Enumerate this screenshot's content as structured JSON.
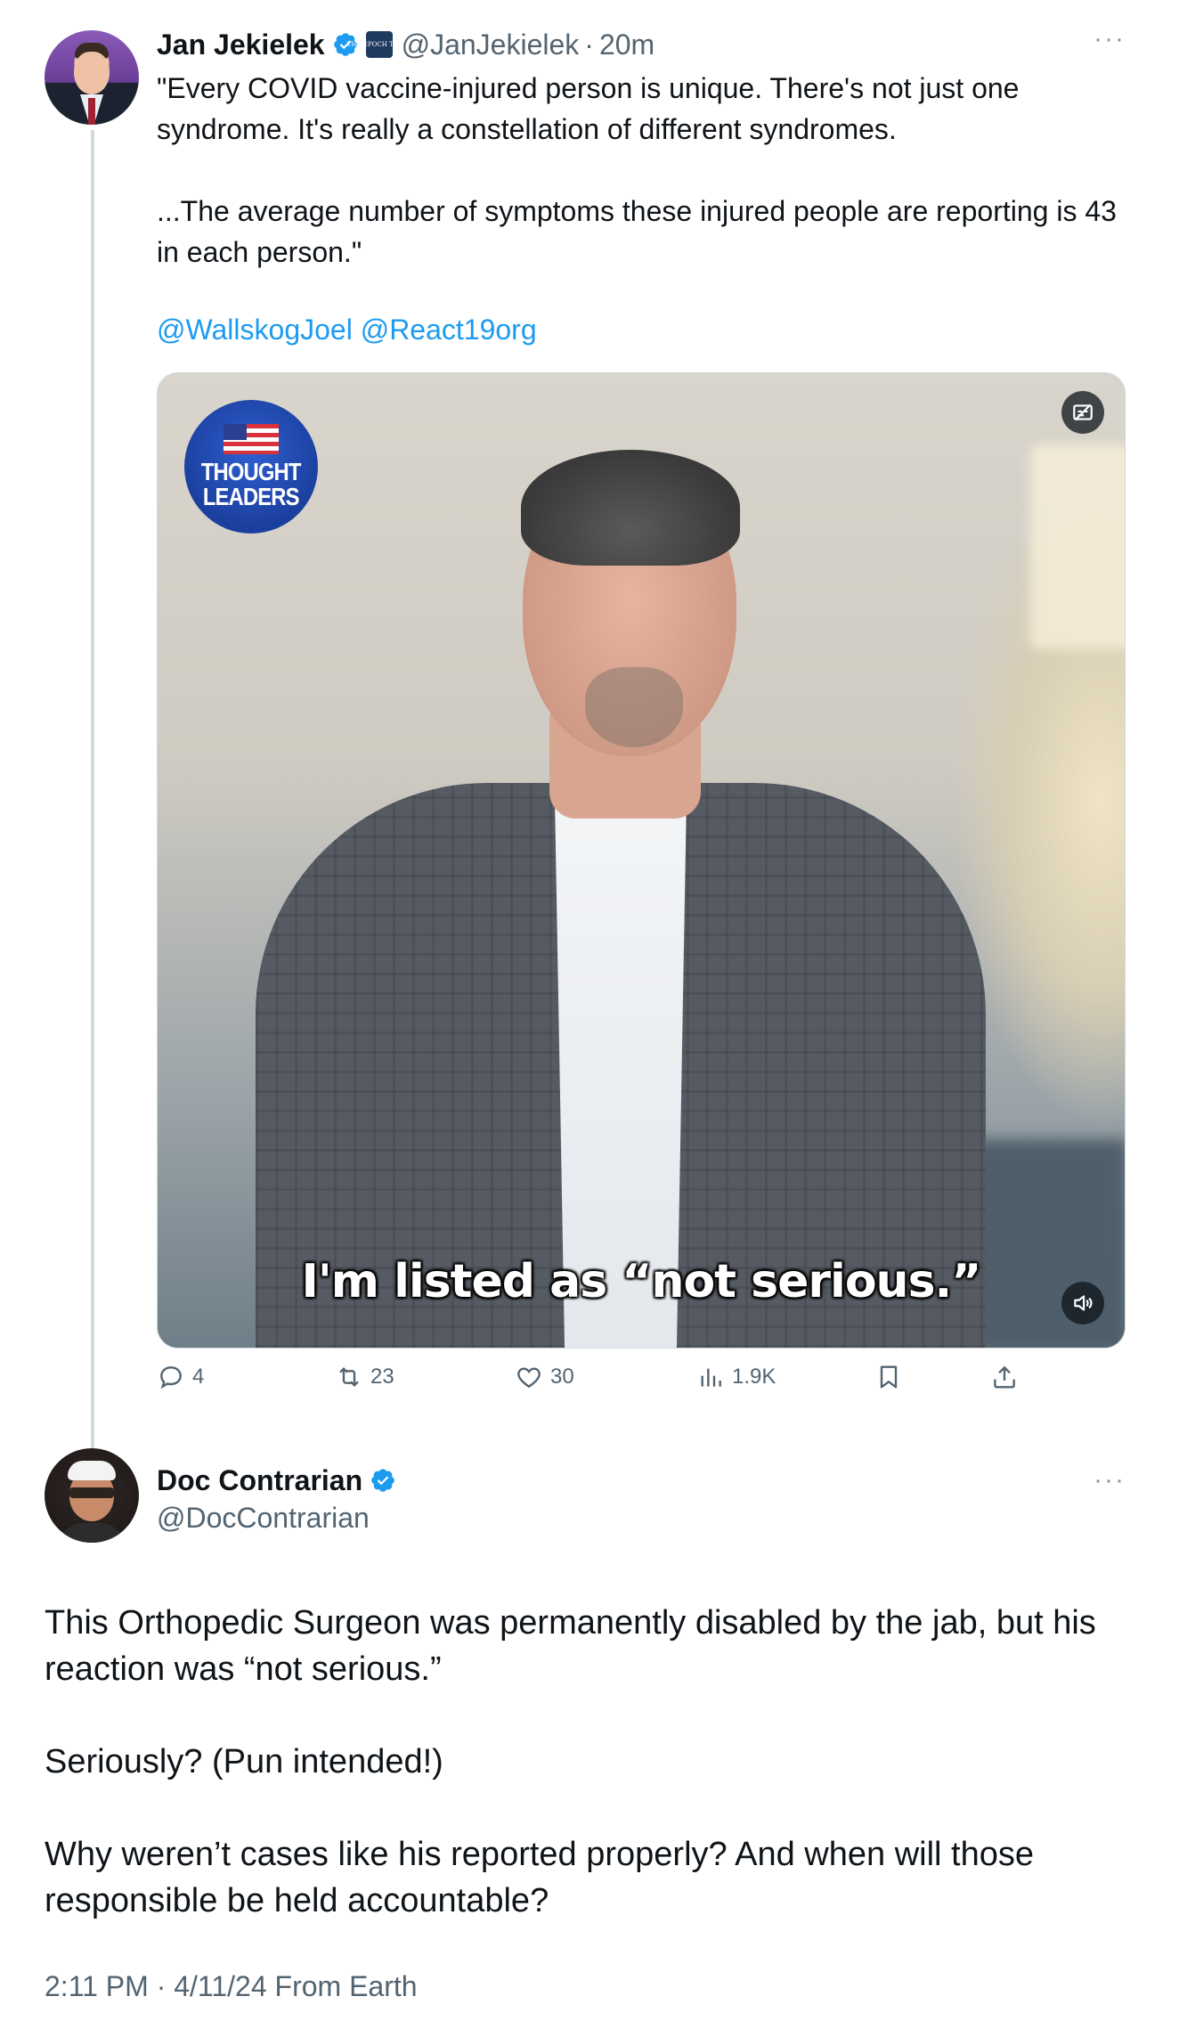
{
  "thread_tweet": {
    "author_name": "Jan Jekielek",
    "affiliation_badge_text": "THE EPOCH TIMES",
    "handle": "@JanJekielek",
    "separator": "·",
    "time": "20m",
    "text": "\"Every COVID vaccine-injured person is unique. There's not just one syndrome. It's really a constellation of different syndromes.\n\n...The average number of symptoms these injured people are reporting is 43 in each person.\"",
    "mentions": [
      "@WallskogJoel",
      "@React19org"
    ],
    "video": {
      "badge_text_line1": "THOUGHT",
      "badge_text_line2": "LEADERS",
      "caption": "I'm listed as “not serious.”",
      "icons": [
        "captions-icon",
        "volume-icon"
      ]
    },
    "actions": {
      "replies": "4",
      "reposts": "23",
      "likes": "30",
      "views": "1.9K"
    },
    "more_icon": "more-icon"
  },
  "main_tweet": {
    "author_name": "Doc Contrarian",
    "handle": "@DocContrarian",
    "paragraphs": [
      "This Orthopedic Surgeon was permanently disabled by the jab, but his reaction was “not serious.”",
      "Seriously? (Pun intended!)",
      "Why weren’t cases like his reported properly? And when will those responsible be held accountable?"
    ],
    "meta": "2:11 PM · 4/11/24 From Earth"
  },
  "colors": {
    "text": "#0f1419",
    "secondary": "#536471",
    "link": "#1d9bf0",
    "verified": "#1d9bf0",
    "thread_line": "#cfd9de"
  }
}
